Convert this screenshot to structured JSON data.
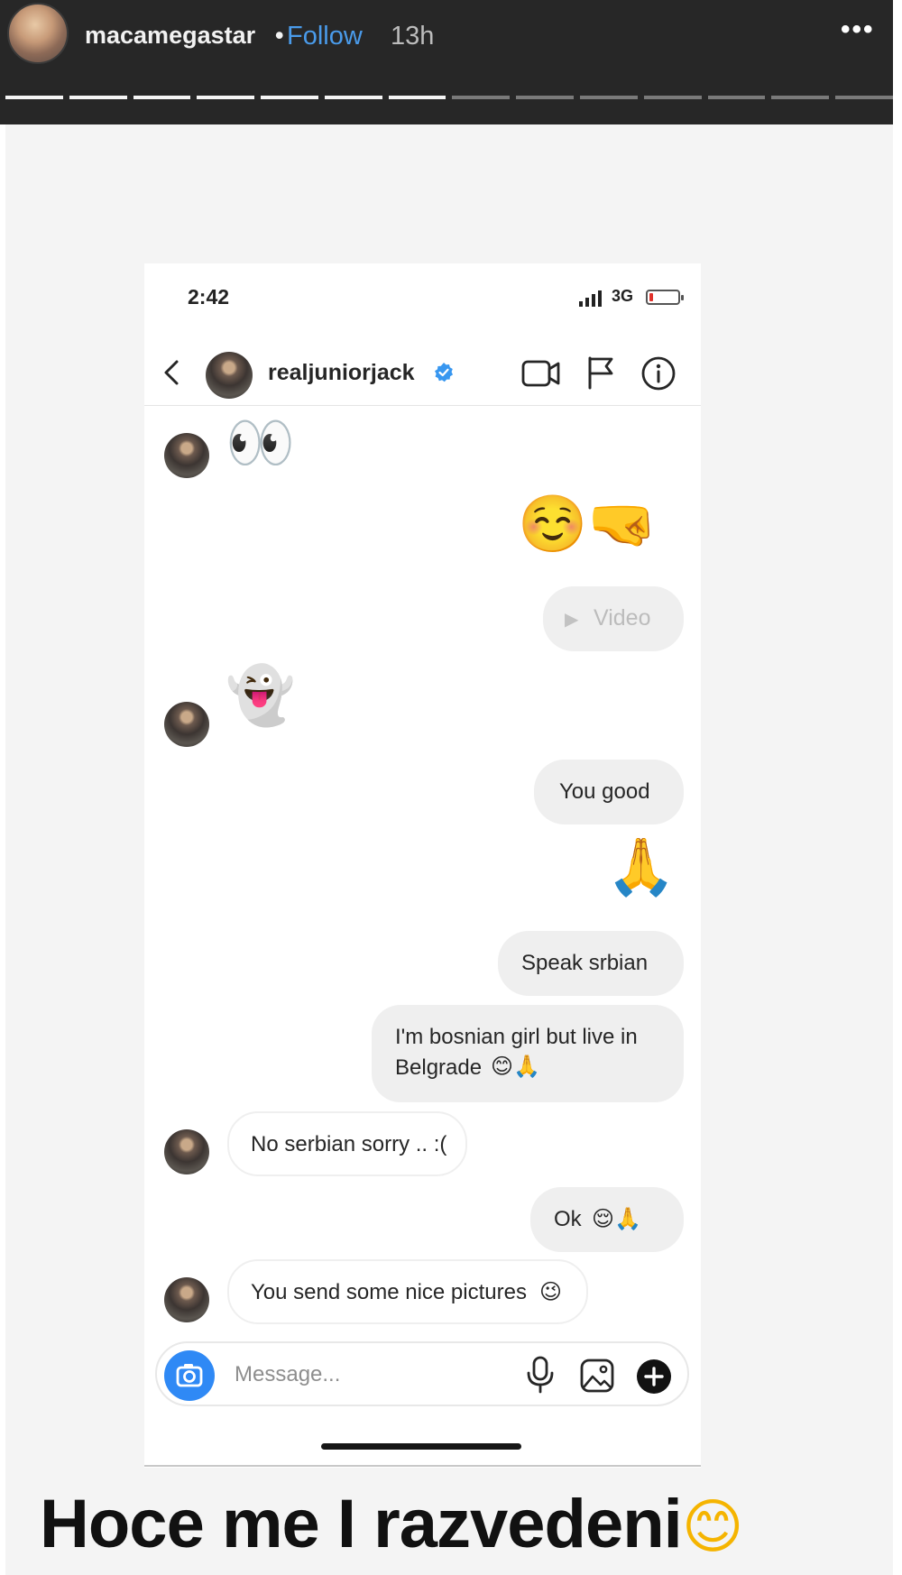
{
  "story": {
    "username": "macamegastar",
    "separator": "•",
    "follow_label": "Follow",
    "time": "13h",
    "more_label": "•••",
    "segments_total": 14,
    "segments_seen": 7
  },
  "phone": {
    "status": {
      "time": "2:42",
      "network": "3G",
      "battery": 0.12
    },
    "header": {
      "username": "realjuniorjack",
      "verified": true
    }
  },
  "messages": [
    {
      "from": "them",
      "kind": "emoji",
      "text": "👀"
    },
    {
      "from": "me",
      "kind": "emoji",
      "text": "☺️🤜"
    },
    {
      "from": "me",
      "kind": "video",
      "text": "Video",
      "play": "▶"
    },
    {
      "from": "them",
      "kind": "emoji",
      "text": "👻"
    },
    {
      "from": "me",
      "kind": "text",
      "text": "You good"
    },
    {
      "from": "me",
      "kind": "emoji",
      "text": "🙏"
    },
    {
      "from": "me",
      "kind": "text",
      "text": "Speak srbian"
    },
    {
      "from": "me",
      "kind": "text",
      "lines": [
        "I'm bosnian girl but live in",
        "Belgrade"
      ],
      "emoji": "😊🙏"
    },
    {
      "from": "them",
      "kind": "text",
      "text": "No serbian sorry .. :("
    },
    {
      "from": "me",
      "kind": "text",
      "text": "Ok",
      "emoji": "😌🙏"
    },
    {
      "from": "them",
      "kind": "text",
      "text": "You send some nice pictures",
      "emoji": "😉"
    }
  ],
  "composer": {
    "placeholder": "Message..."
  },
  "caption": {
    "text": "Hoce me I razvedeni",
    "emoji": "😊"
  },
  "colors": {
    "accent_blue": "#4a9bea",
    "camera_blue": "#2f89f5",
    "verified_blue": "#3897f0",
    "bubble_gray": "#efefef",
    "story_bar": "#272727"
  }
}
